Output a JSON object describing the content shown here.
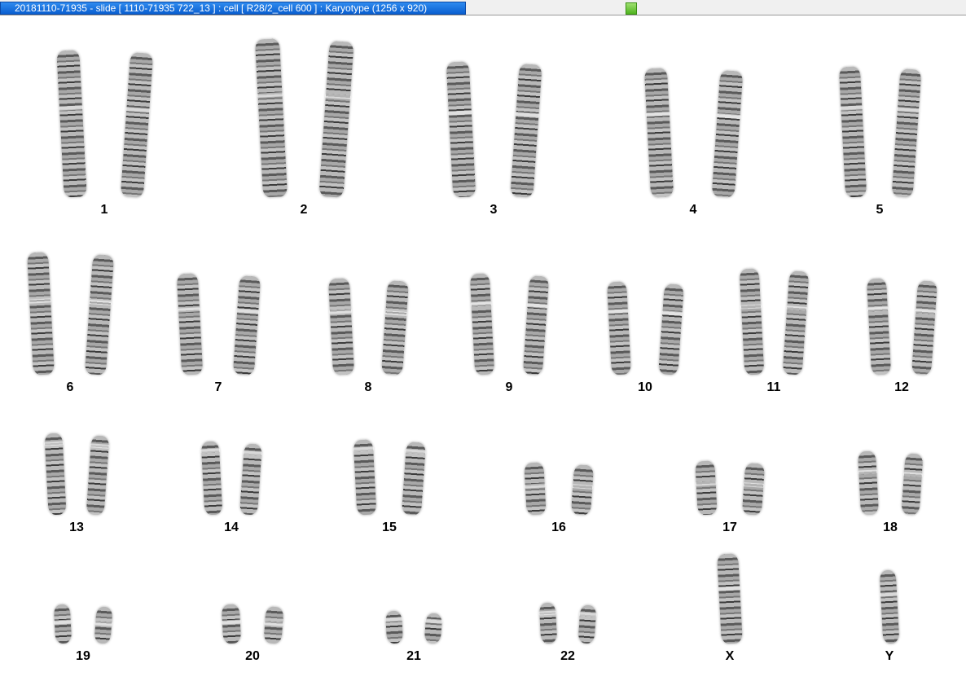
{
  "window": {
    "title": "20181110-71935 - slide [ 1110-71935 722_13 ] : cell [ R28/2_cell 600 ] : Karyotype  (1256 x 920)",
    "status_color": "#5dbb2a"
  },
  "karyotype": {
    "chromosomes": [
      {
        "label": "1"
      },
      {
        "label": "2"
      },
      {
        "label": "3"
      },
      {
        "label": "4"
      },
      {
        "label": "5"
      },
      {
        "label": "6"
      },
      {
        "label": "7"
      },
      {
        "label": "8"
      },
      {
        "label": "9"
      },
      {
        "label": "10"
      },
      {
        "label": "11"
      },
      {
        "label": "12"
      },
      {
        "label": "13"
      },
      {
        "label": "14"
      },
      {
        "label": "15"
      },
      {
        "label": "16"
      },
      {
        "label": "17"
      },
      {
        "label": "18"
      },
      {
        "label": "19"
      },
      {
        "label": "20"
      },
      {
        "label": "21"
      },
      {
        "label": "22"
      },
      {
        "label": "X"
      },
      {
        "label": "Y"
      }
    ]
  }
}
